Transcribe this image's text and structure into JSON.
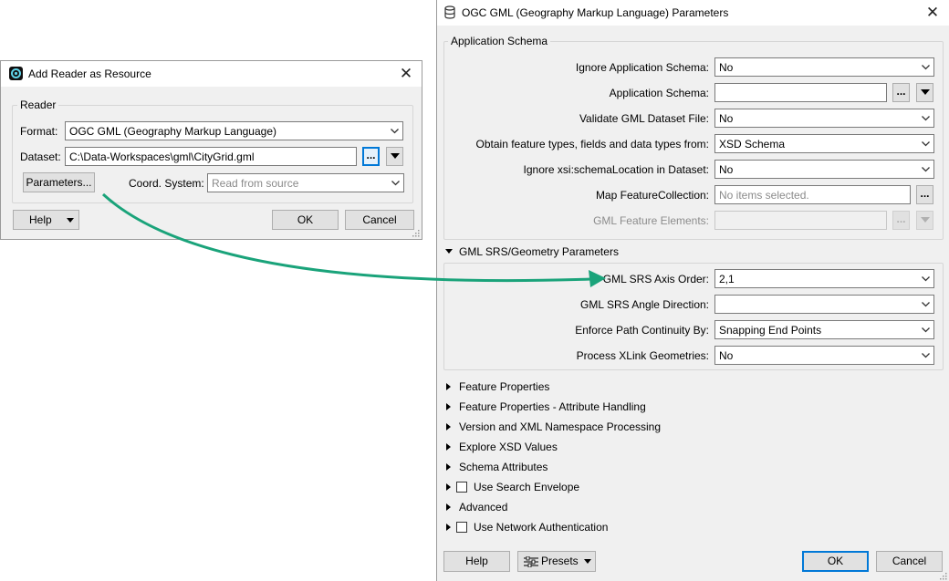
{
  "add_reader": {
    "title": "Add Reader as Resource",
    "group_label": "Reader",
    "format_label": "Format:",
    "format_value": "OGC GML (Geography Markup Language)",
    "dataset_label": "Dataset:",
    "dataset_value": "C:\\Data-Workspaces\\gml\\CityGrid.gml",
    "browse_label": "...",
    "parameters_label": "Parameters...",
    "coord_label": "Coord. System:",
    "coord_placeholder": "Read from source",
    "help_label": "Help",
    "ok_label": "OK",
    "cancel_label": "Cancel"
  },
  "params": {
    "title": "OGC GML (Geography Markup Language) Parameters",
    "app_schema": {
      "label": "Application Schema",
      "rows": [
        {
          "label": "Ignore Application Schema:",
          "value": "No"
        },
        {
          "label": "Application Schema:",
          "value": ""
        },
        {
          "label": "Validate GML Dataset File:",
          "value": "No"
        },
        {
          "label": "Obtain feature types, fields and data types from:",
          "value": "XSD Schema"
        },
        {
          "label": "Ignore xsi:schemaLocation in Dataset:",
          "value": "No"
        },
        {
          "label": "Map FeatureCollection:",
          "placeholder": "No items selected."
        },
        {
          "label": "GML Feature Elements:",
          "value": ""
        }
      ]
    },
    "srs": {
      "label": "GML SRS/Geometry Parameters",
      "rows": [
        {
          "label": "GML SRS Axis Order:",
          "value": "2,1"
        },
        {
          "label": "GML SRS Angle Direction:",
          "value": ""
        },
        {
          "label": "Enforce Path Continuity By:",
          "value": "Snapping End Points"
        },
        {
          "label": "Process XLink Geometries:",
          "value": "No"
        }
      ]
    },
    "sections": [
      "Feature Properties",
      "Feature Properties - Attribute Handling",
      "Version and XML Namespace Processing",
      "Explore XSD Values",
      "Schema Attributes",
      "Use Search Envelope",
      "Advanced",
      "Use Network Authentication"
    ],
    "browse_label": "...",
    "help_label": "Help",
    "presets_label": "Presets",
    "ok_label": "OK",
    "cancel_label": "Cancel"
  },
  "colors": {
    "arrow": "#1aa37a",
    "accent": "#0078d7",
    "dialog_bg": "#f0f0f0"
  }
}
